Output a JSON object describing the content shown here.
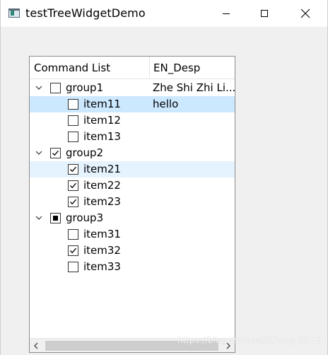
{
  "window": {
    "title": "testTreeWidgetDemo"
  },
  "tree": {
    "columns": [
      "Command List",
      "EN_Desp"
    ],
    "rows": [
      {
        "label": "group1",
        "desc": "Zhe Shi Zhi Li...",
        "expanded": true,
        "checked": "unchecked",
        "level": 0
      },
      {
        "label": "item11",
        "desc": "hello",
        "checked": "unchecked",
        "level": 1,
        "state": "selected"
      },
      {
        "label": "item12",
        "desc": "",
        "checked": "unchecked",
        "level": 1
      },
      {
        "label": "item13",
        "desc": "",
        "checked": "unchecked",
        "level": 1
      },
      {
        "label": "group2",
        "desc": "",
        "expanded": true,
        "checked": "checked",
        "level": 0
      },
      {
        "label": "item21",
        "desc": "",
        "checked": "checked",
        "level": 1,
        "state": "hover"
      },
      {
        "label": "item22",
        "desc": "",
        "checked": "checked",
        "level": 1
      },
      {
        "label": "item23",
        "desc": "",
        "checked": "checked",
        "level": 1
      },
      {
        "label": "group3",
        "desc": "",
        "expanded": true,
        "checked": "partial",
        "level": 0
      },
      {
        "label": "item31",
        "desc": "",
        "checked": "unchecked",
        "level": 1
      },
      {
        "label": "item32",
        "desc": "",
        "checked": "checked",
        "level": 1
      },
      {
        "label": "item33",
        "desc": "",
        "checked": "unchecked",
        "level": 1
      }
    ]
  },
  "watermark": "https://blog.csdn.net/Zhong_0512",
  "colors": {
    "selected": "#cce8ff",
    "hover": "#e5f3ff",
    "titlebar": "#ffffff",
    "window_bg": "#f0f0f0"
  },
  "icons": {
    "minimize": "minimize-icon",
    "maximize": "maximize-icon",
    "close": "close-icon",
    "expand": "chevron-down-icon",
    "scroll_left": "chevron-left-icon",
    "scroll_right": "chevron-right-icon"
  }
}
